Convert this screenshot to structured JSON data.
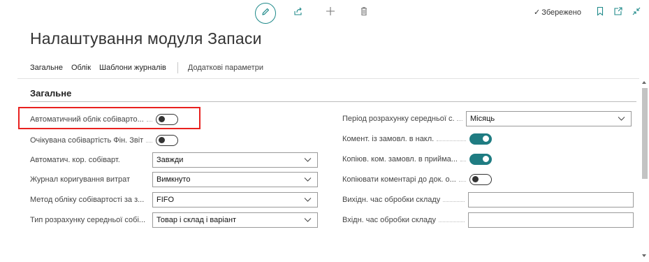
{
  "toolbar": {
    "edit_icon": "pencil-icon",
    "share_icon": "share-icon",
    "new_icon": "plus-icon",
    "delete_icon": "trash-icon",
    "saved_check": "✓",
    "saved_label": "Збережено",
    "bookmark_icon": "bookmark-icon",
    "open_new_window_icon": "open-in-new-window-icon",
    "collapse_icon": "collapse-icon"
  },
  "page": {
    "title": "Налаштування модуля Запаси"
  },
  "tabs": [
    {
      "label": "Загальне"
    },
    {
      "label": "Облік"
    },
    {
      "label": "Шаблони журналів"
    },
    {
      "label": "Додаткові параметри"
    }
  ],
  "section": {
    "title": "Загальне"
  },
  "left_fields": [
    {
      "label": "Автоматичний облік собіварто...",
      "type": "toggle",
      "value": false
    },
    {
      "label": "Очікувана собівартість Фін. Звіт",
      "type": "toggle",
      "value": false
    },
    {
      "label": "Автоматич. кор. собіварт.",
      "type": "select",
      "value": "Завжди"
    },
    {
      "label": "Журнал коригування витрат",
      "type": "select",
      "value": "Вимкнуто"
    },
    {
      "label": "Метод обліку собівартості за з...",
      "type": "select",
      "value": "FIFO"
    },
    {
      "label": "Тип розрахунку середньої собі...",
      "type": "select",
      "value": "Товар і склад і варіант"
    }
  ],
  "right_fields": [
    {
      "label": "Період розрахунку середньої с...",
      "type": "select",
      "value": "Місяць"
    },
    {
      "label": "Комент. із замовл. в накл.",
      "type": "toggle",
      "value": true
    },
    {
      "label": "Копіюв. ком. замовл. в прийма...",
      "type": "toggle",
      "value": true
    },
    {
      "label": "Копіювати коментарі до док. о...",
      "type": "toggle",
      "value": false
    },
    {
      "label": "Вихідн. час обробки складу",
      "type": "text",
      "value": ""
    },
    {
      "label": "Вхідн. час обробки складу",
      "type": "text",
      "value": ""
    }
  ],
  "colors": {
    "accent": "#1f7c82",
    "highlight": "#e8211f"
  }
}
